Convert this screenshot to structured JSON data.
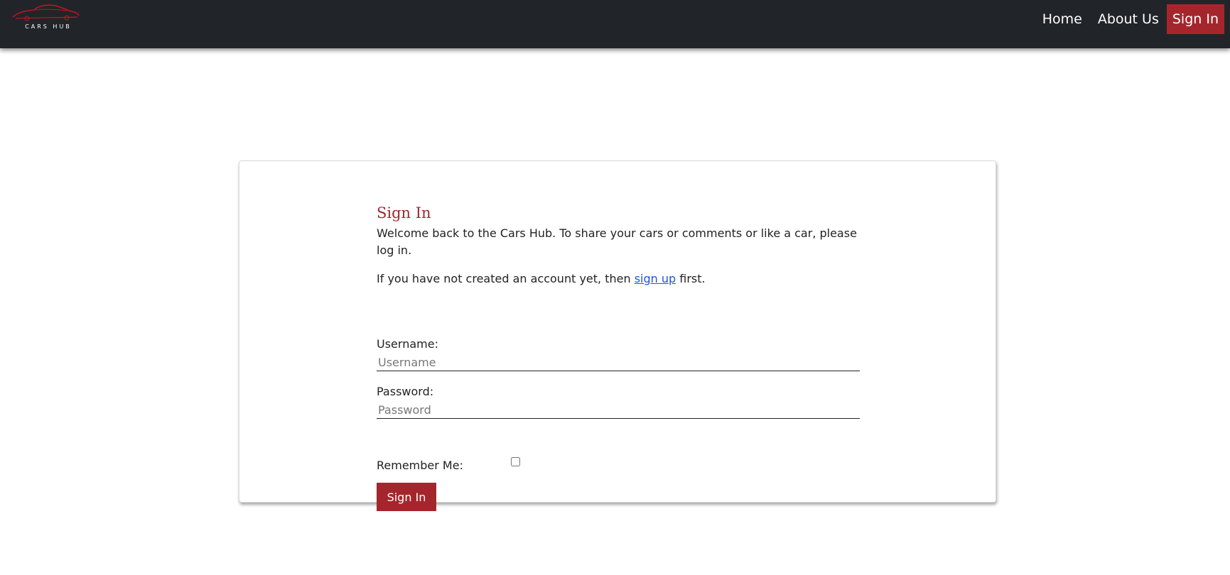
{
  "brand": {
    "logo_icon": "car-silhouette-icon",
    "name": "CARS HUB",
    "accent_color": "#a4262c"
  },
  "nav": {
    "items": [
      {
        "label": "Home"
      },
      {
        "label": "About Us"
      },
      {
        "label": "Sign In"
      }
    ]
  },
  "signin": {
    "title": "Sign In",
    "intro": "Welcome back to the Cars Hub. To share your cars or comments or like a car, please log in.",
    "signup_prefix": "If you have not created an account yet, then ",
    "signup_link": "sign up",
    "signup_suffix": " first.",
    "username_label": "Username:",
    "username_placeholder": "Username",
    "password_label": "Password:",
    "password_placeholder": "Password",
    "remember_label": "Remember Me:",
    "remember_checked": false,
    "submit_label": "Sign In"
  }
}
